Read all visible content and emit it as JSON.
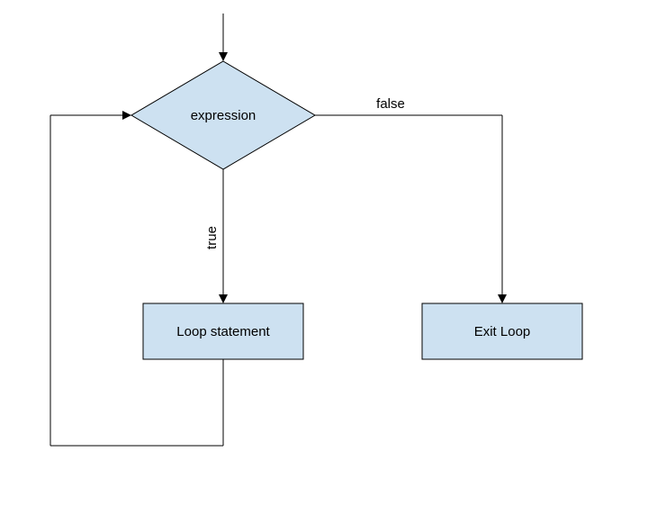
{
  "diagram": {
    "decision_label": "expression",
    "loop_box_label": "Loop statement",
    "exit_box_label": "Exit Loop",
    "true_label": "true",
    "false_label": "false"
  }
}
